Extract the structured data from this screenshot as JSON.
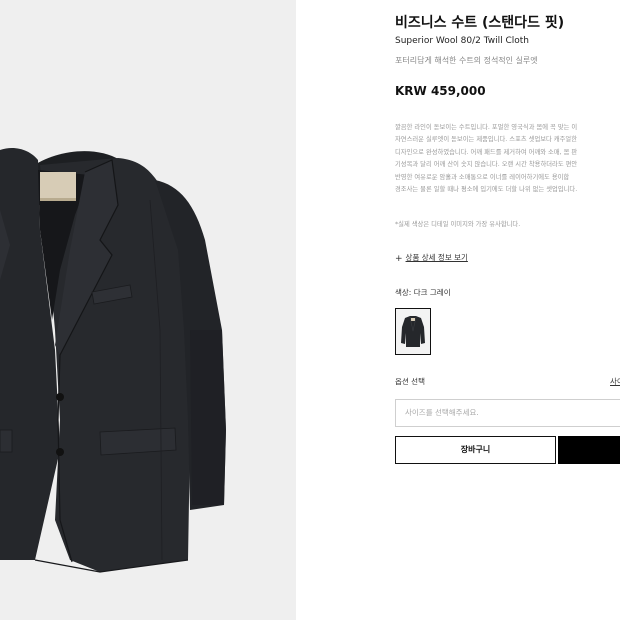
{
  "product": {
    "title": "비즈니스 수트 (스탠다드 핏)",
    "subtitle": "Superior Wool 80/2 Twill Cloth",
    "tagline": "포터리답게 해석한 수트의 정석적인 실루엣",
    "price": "KRW 459,000"
  },
  "description": {
    "lines": [
      "깔끔한 라인이 돋보이는 수트입니다. 포멀한 영국식과 몸에 꼭 맞는 이",
      "자연스러운 실루엣이 돋보이는 제품입니다. 스포츠 셋업보다 캐주얼한",
      "디자인으로 완성하였습니다. 어깨 패드를 제거하여 어깨와 소매, 몸 판",
      "기성복과 달리 어깨 산이 솟지 않습니다. 오랜 시간 착용하더라도 편안",
      "반영한 여유로운 암홀과 소매통으로 이너를 레이어하기에도 용이합",
      "경조사는 물론 일할 때나 평소에 입기에도 더할 나위 없는 셋업입니다."
    ],
    "note": "*실제 색상은 디테일 이미지와 가장 유사합니다."
  },
  "details_link": {
    "icon": "plus-icon",
    "label": "상품 상세 정보 보기"
  },
  "color": {
    "label": "색상: 다크 그레이",
    "swatch_color": "#2a2c30"
  },
  "option": {
    "label": "옵션 선택",
    "size_guide": "사이",
    "placeholder": "사이즈를 선택해주세요."
  },
  "actions": {
    "cart_label": "장바구니"
  },
  "colors": {
    "gallery_bg": "#efefef",
    "jacket": "#25272b",
    "text_muted": "#999999",
    "border": "#111111"
  }
}
